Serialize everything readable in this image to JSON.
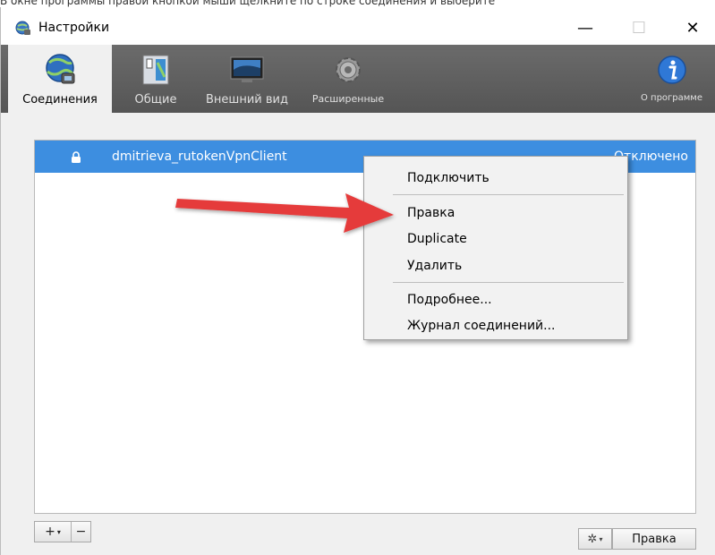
{
  "caption": "В окне программы правой кнопкой мыши щелкните по строке соединения и выберите",
  "window": {
    "title": "Настройки",
    "controls": {
      "minimize": "—",
      "maximize": "☐",
      "close": "✕"
    }
  },
  "toolbar": {
    "items": [
      {
        "label": "Соединения",
        "icon": "globe-network-icon",
        "active": true
      },
      {
        "label": "Общие",
        "icon": "switch-panel-icon",
        "active": false
      },
      {
        "label": "Внешний вид",
        "icon": "monitor-icon",
        "active": false
      },
      {
        "label": "Расширенные",
        "icon": "gear-icon",
        "active": false
      }
    ],
    "about": {
      "label": "О программе",
      "icon": "info-icon"
    }
  },
  "connections": [
    {
      "name": "dmitrieva_rutokenVpnClient",
      "status": "Отключено",
      "icon": "lock-icon",
      "selected": true
    }
  ],
  "context_menu": {
    "items": [
      "Подключить",
      "Правка",
      "Duplicate",
      "Удалить",
      "Подробнее...",
      "Журнал соединений..."
    ]
  },
  "bottom": {
    "add_label": "+",
    "remove_label": "−",
    "gear_label": "✲",
    "edit_label": "Правка"
  },
  "colors": {
    "selection": "#3d8ee0",
    "toolbar": "#5e5e5e",
    "arrow": "#e53b3b"
  }
}
